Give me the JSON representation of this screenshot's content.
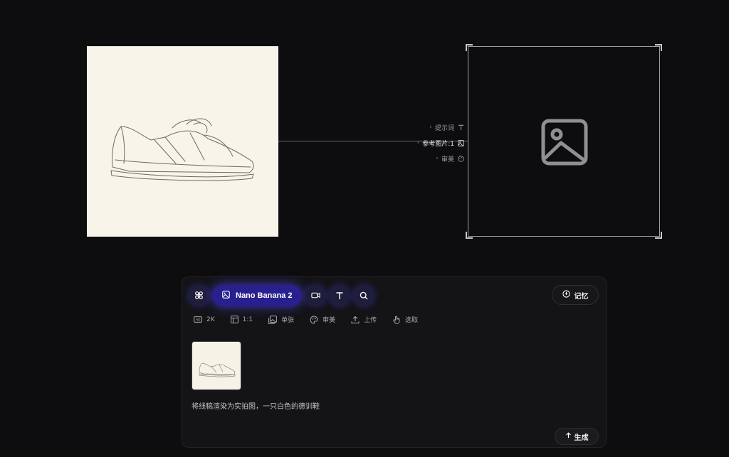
{
  "canvas": {
    "ports": [
      {
        "label": "提示词",
        "icon": "text-icon"
      },
      {
        "label": "参考图片:1",
        "icon": "image-icon"
      },
      {
        "label": "审美",
        "icon": "palette-icon"
      }
    ],
    "output_placeholder_icon": "image-placeholder-icon"
  },
  "panel": {
    "tools": [
      {
        "name": "nodes-tool",
        "icon": "nodes-icon"
      },
      {
        "name": "video-tool",
        "icon": "video-icon"
      },
      {
        "name": "text-tool",
        "icon": "text-icon"
      },
      {
        "name": "search-tool",
        "icon": "search-icon"
      }
    ],
    "model_label": "Nano Banana 2",
    "memory_label": "记忆",
    "options": [
      {
        "label": "2K",
        "icon": "hd-icon"
      },
      {
        "label": "1:1",
        "icon": "aspect-icon"
      },
      {
        "label": "单张",
        "icon": "images-icon"
      },
      {
        "label": "审美",
        "icon": "palette-icon"
      },
      {
        "label": "上传",
        "icon": "upload-icon"
      },
      {
        "label": "选取",
        "icon": "hand-pointer-icon"
      }
    ],
    "prompt_text": "将线稿渲染为实拍图，一只白色的德训鞋",
    "generate_label": "生成"
  },
  "colors": {
    "background": "#0d0d0f",
    "accent": "#28208f",
    "sketch_paper": "#f8f4e9"
  }
}
